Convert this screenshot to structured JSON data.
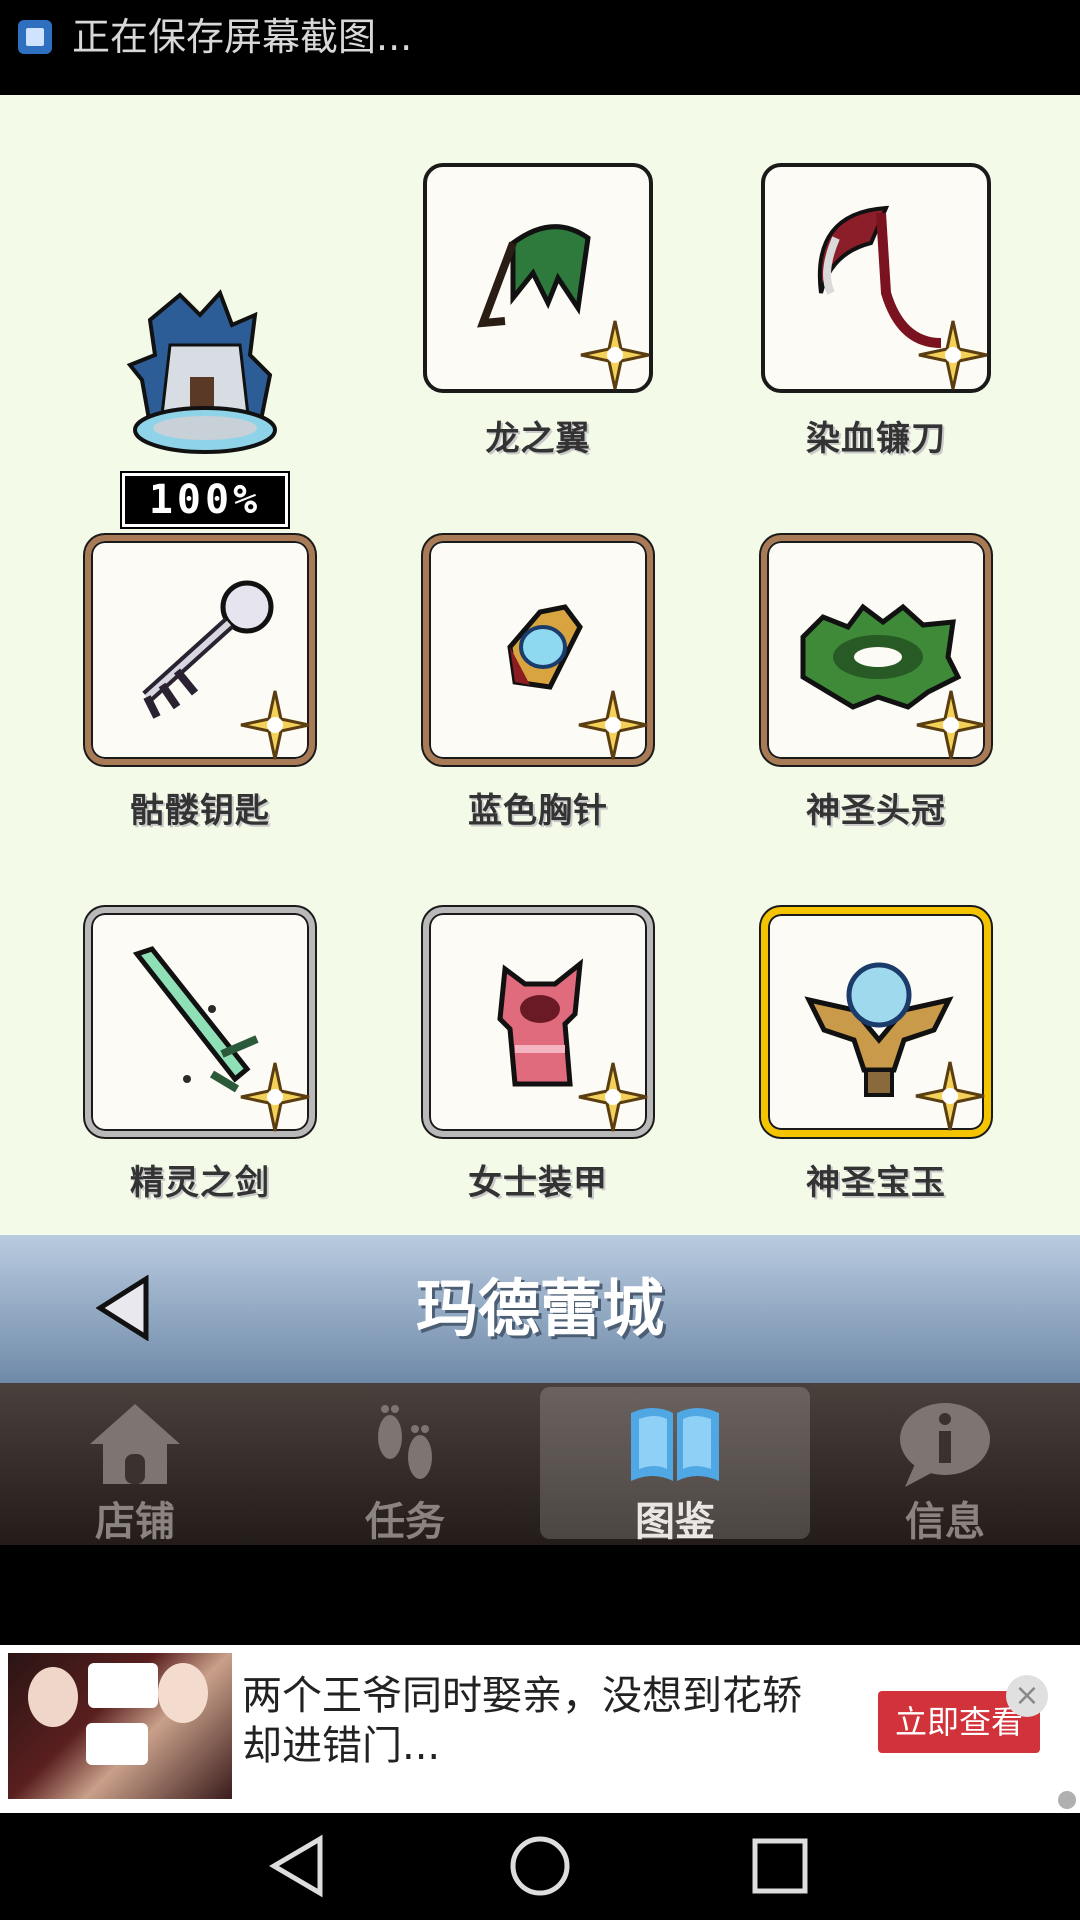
{
  "status_bar": {
    "text": "正在保存屏幕截图..."
  },
  "collection": {
    "percent": "100%",
    "items": [
      {
        "label": "龙之翼",
        "icon": "dragon-wing-icon",
        "frame": "black"
      },
      {
        "label": "染血镰刀",
        "icon": "bloody-scythe-icon",
        "frame": "black"
      },
      {
        "label": "骷髅钥匙",
        "icon": "skull-key-icon",
        "frame": "bronze"
      },
      {
        "label": "蓝色胸针",
        "icon": "blue-brooch-icon",
        "frame": "bronze"
      },
      {
        "label": "神圣头冠",
        "icon": "holy-crown-icon",
        "frame": "bronze"
      },
      {
        "label": "精灵之剑",
        "icon": "elf-sword-icon",
        "frame": "silver"
      },
      {
        "label": "女士装甲",
        "icon": "lady-armor-icon",
        "frame": "silver"
      },
      {
        "label": "神圣宝玉",
        "icon": "holy-jewel-icon",
        "frame": "gold"
      }
    ]
  },
  "title_bar": {
    "title": "玛德蕾城"
  },
  "tabs": [
    {
      "label": "店铺",
      "icon": "house-icon"
    },
    {
      "label": "任务",
      "icon": "footprints-icon"
    },
    {
      "label": "图鉴",
      "icon": "book-icon",
      "active": true
    },
    {
      "label": "信息",
      "icon": "info-bubble-icon"
    }
  ],
  "ad": {
    "text": "两个王爷同时娶亲，没想到花轿却进错门...",
    "button": "立即查看",
    "close": "×"
  },
  "colors": {
    "grid_bg": "#f3fbe8",
    "title_bar": "#8aa3bf",
    "ad_button": "#d2323a",
    "gold_frame": "#f5c400"
  }
}
